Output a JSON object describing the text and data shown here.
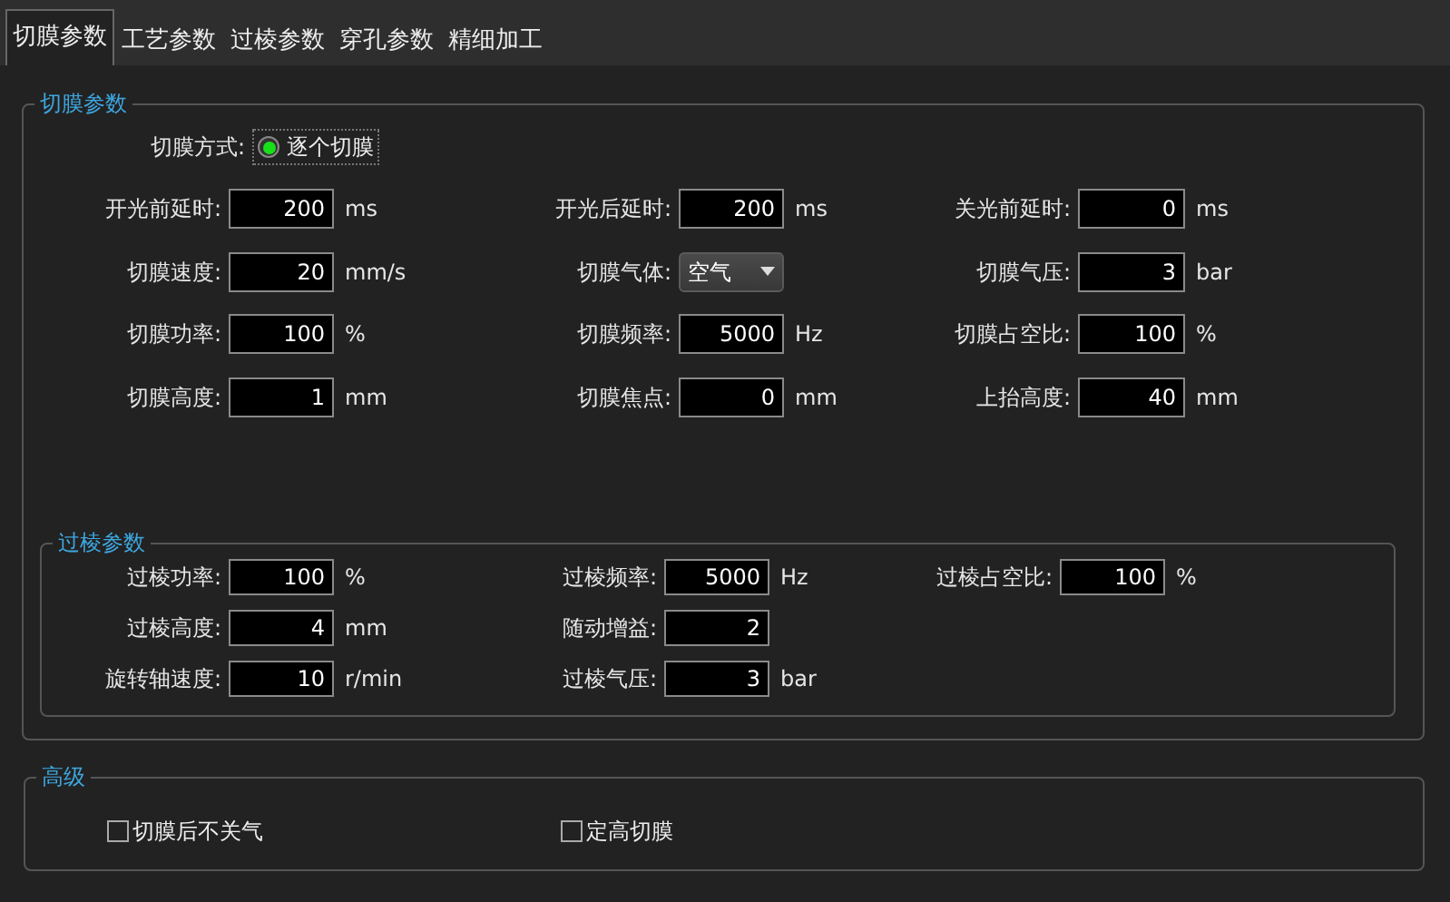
{
  "tabs": [
    {
      "label": "切膜参数",
      "selected": true
    },
    {
      "label": "工艺参数",
      "selected": false
    },
    {
      "label": "过棱参数",
      "selected": false
    },
    {
      "label": "穿孔参数",
      "selected": false
    },
    {
      "label": "精细加工",
      "selected": false
    }
  ],
  "film_group": {
    "title": "切膜参数",
    "mode": {
      "label": "切膜方式:",
      "options": [
        {
          "label": "逐个切膜",
          "selected": true
        }
      ]
    },
    "rows": [
      [
        {
          "kind": "number",
          "label": "开光前延时:",
          "value": "200",
          "unit": "ms"
        },
        {
          "kind": "number",
          "label": "开光后延时:",
          "value": "200",
          "unit": "ms"
        },
        {
          "kind": "number",
          "label": "关光前延时:",
          "value": "0",
          "unit": "ms"
        }
      ],
      [
        {
          "kind": "number",
          "label": "切膜速度:",
          "value": "20",
          "unit": "mm/s"
        },
        {
          "kind": "dropdown",
          "label": "切膜气体:",
          "value": "空气"
        },
        {
          "kind": "number",
          "label": "切膜气压:",
          "value": "3",
          "unit": "bar"
        }
      ],
      [
        {
          "kind": "number",
          "label": "切膜功率:",
          "value": "100",
          "unit": "%"
        },
        {
          "kind": "number",
          "label": "切膜频率:",
          "value": "5000",
          "unit": "Hz"
        },
        {
          "kind": "number",
          "label": "切膜占空比:",
          "value": "100",
          "unit": "%"
        }
      ],
      [
        {
          "kind": "number",
          "label": "切膜高度:",
          "value": "1",
          "unit": "mm"
        },
        {
          "kind": "number",
          "label": "切膜焦点:",
          "value": "0",
          "unit": "mm"
        },
        {
          "kind": "number",
          "label": "上抬高度:",
          "value": "40",
          "unit": "mm"
        }
      ]
    ],
    "edge_group": {
      "title": "过棱参数",
      "rows": [
        [
          {
            "kind": "number",
            "label": "过棱功率:",
            "value": "100",
            "unit": "%"
          },
          {
            "kind": "number",
            "label": "过棱频率:",
            "value": "5000",
            "unit": "Hz"
          },
          {
            "kind": "number",
            "label": "过棱占空比:",
            "value": "100",
            "unit": "%"
          }
        ],
        [
          {
            "kind": "number",
            "label": "过棱高度:",
            "value": "4",
            "unit": "mm"
          },
          {
            "kind": "number",
            "label": "随动增益:",
            "value": "2"
          }
        ],
        [
          {
            "kind": "number",
            "label": "旋转轴速度:",
            "value": "10",
            "unit": "r/min"
          },
          {
            "kind": "number",
            "label": "过棱气压:",
            "value": "3",
            "unit": "bar"
          }
        ]
      ]
    }
  },
  "advanced_group": {
    "title": "高级",
    "options": [
      {
        "label": "切膜后不关气",
        "checked": false
      },
      {
        "label": "定高切膜",
        "checked": false
      }
    ]
  }
}
